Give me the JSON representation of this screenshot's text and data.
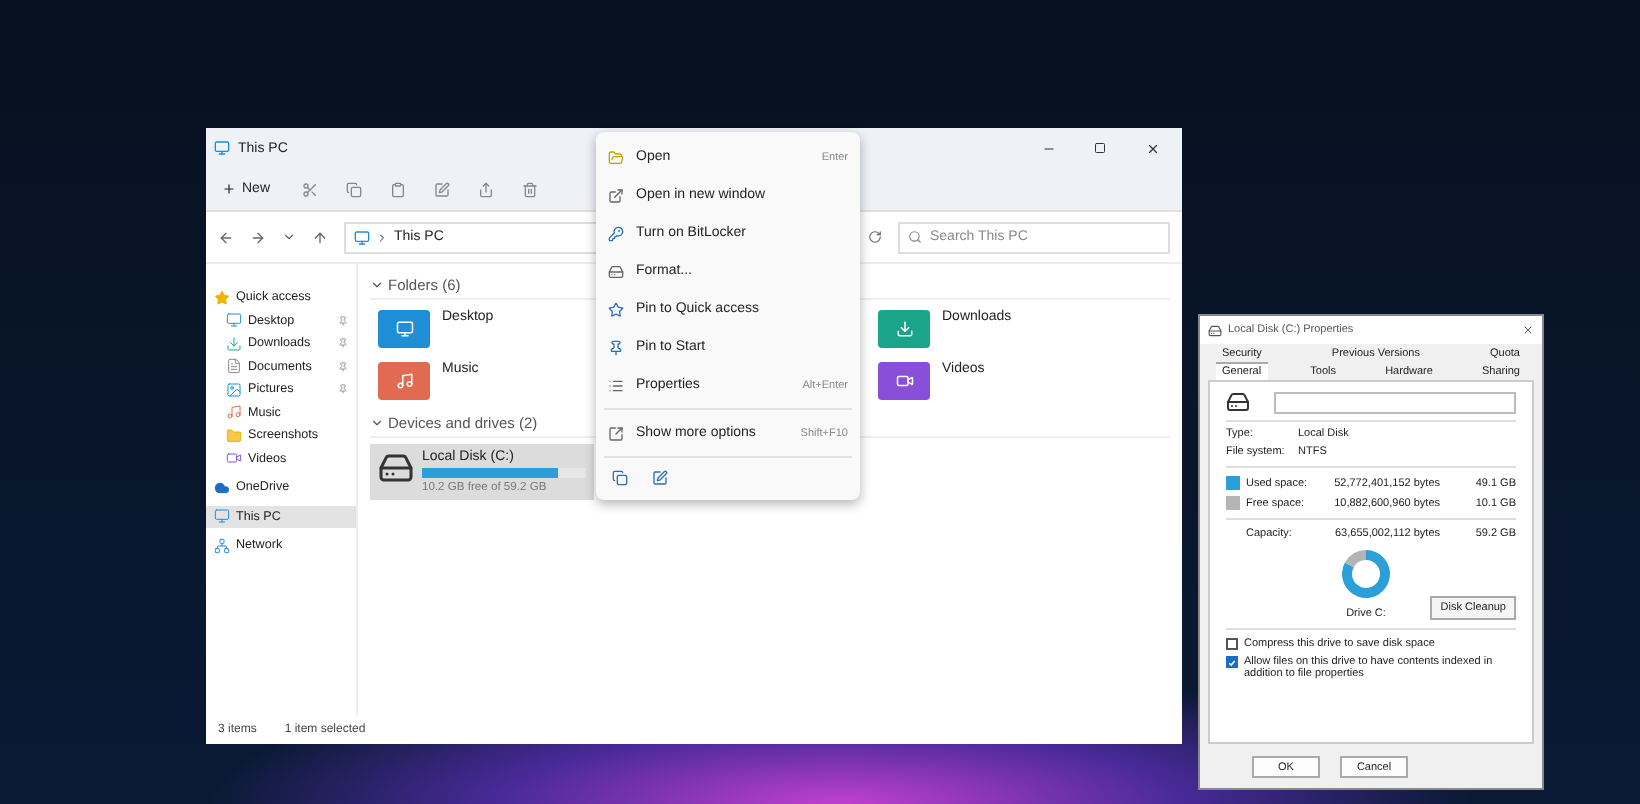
{
  "explorer": {
    "title": "This PC",
    "new_button": "New",
    "path": "This PC",
    "search": {
      "placeholder": "Search This PC"
    },
    "sidebar": {
      "items": [
        {
          "label": "Quick access",
          "selected": false,
          "children": [
            {
              "label": "Desktop",
              "selected": false,
              "pinned": true
            },
            {
              "label": "Downloads",
              "selected": false,
              "pinned": true
            },
            {
              "label": "Documents",
              "selected": false,
              "pinned": true
            },
            {
              "label": "Pictures",
              "selected": false,
              "pinned": true
            },
            {
              "label": "Music",
              "selected": false,
              "pinned": false
            },
            {
              "label": "Screenshots",
              "selected": false,
              "pinned": false
            },
            {
              "label": "Videos",
              "selected": false,
              "pinned": false
            }
          ]
        },
        {
          "label": "OneDrive",
          "selected": false
        },
        {
          "label": "This PC",
          "selected": true
        },
        {
          "label": "Network",
          "selected": false
        }
      ]
    },
    "folders": {
      "header": "Folders (6)",
      "items": [
        {
          "label": "Desktop",
          "color": "#1e8fd6"
        },
        {
          "label": "Music",
          "color": "#e06b50"
        },
        {
          "label": "Downloads",
          "color": "#1aa58a"
        },
        {
          "label": "Videos",
          "color": "#8a4fd8"
        }
      ]
    },
    "drives": {
      "header": "Devices and drives (2)",
      "items": [
        {
          "name": "Local Disk (C:)",
          "level": 0.83,
          "free": "10.2 GB free of 59.2 GB",
          "selected": true
        }
      ]
    },
    "status_bar": {
      "items": "3 items",
      "selection": "1 item selected"
    }
  },
  "context_menu": {
    "items": [
      {
        "label": "Open",
        "shortcut": "Enter"
      },
      {
        "label": "Open in new window"
      },
      {
        "label": "Turn on BitLocker"
      },
      {
        "label": "Format..."
      },
      {
        "label": "Pin to Quick access"
      },
      {
        "label": "Pin to Start"
      },
      {
        "label": "Properties",
        "shortcut": "Alt+Enter"
      }
    ],
    "more": {
      "label": "Show more options",
      "shortcut": "Shift+F10"
    }
  },
  "properties": {
    "title": "Local Disk (C:) Properties",
    "tabs_back": [
      {
        "label": "Security",
        "selected": false
      },
      {
        "label": "Previous Versions",
        "selected": false
      },
      {
        "label": "Quota",
        "selected": false
      }
    ],
    "tabs_front": [
      {
        "label": "General",
        "selected": true
      },
      {
        "label": "Tools",
        "selected": false
      },
      {
        "label": "Hardware",
        "selected": false
      },
      {
        "label": "Sharing",
        "selected": false
      }
    ],
    "info": [
      {
        "label": "Type:",
        "value": "Local Disk"
      },
      {
        "label": "File system:",
        "value": "NTFS"
      }
    ],
    "space": [
      {
        "label": "Used space:",
        "bytes": "52,772,401,152 bytes",
        "size": "49.1 GB",
        "color": "#2a9fd8"
      },
      {
        "label": "Free space:",
        "bytes": "10,882,600,960 bytes",
        "size": "10.1 GB",
        "color": "#b4b4b4"
      }
    ],
    "capacity": {
      "label": "Capacity:",
      "bytes": "63,655,002,112 bytes",
      "size": "59.2 GB"
    },
    "drive_label": "Drive C:",
    "cleanup_button": "Disk Cleanup",
    "options": [
      {
        "label": "Compress this drive to save disk space",
        "checked": false
      },
      {
        "label": "Allow files on this drive to have contents indexed in addition to file properties",
        "checked": true
      }
    ],
    "buttons": [
      "OK",
      "Cancel"
    ]
  }
}
